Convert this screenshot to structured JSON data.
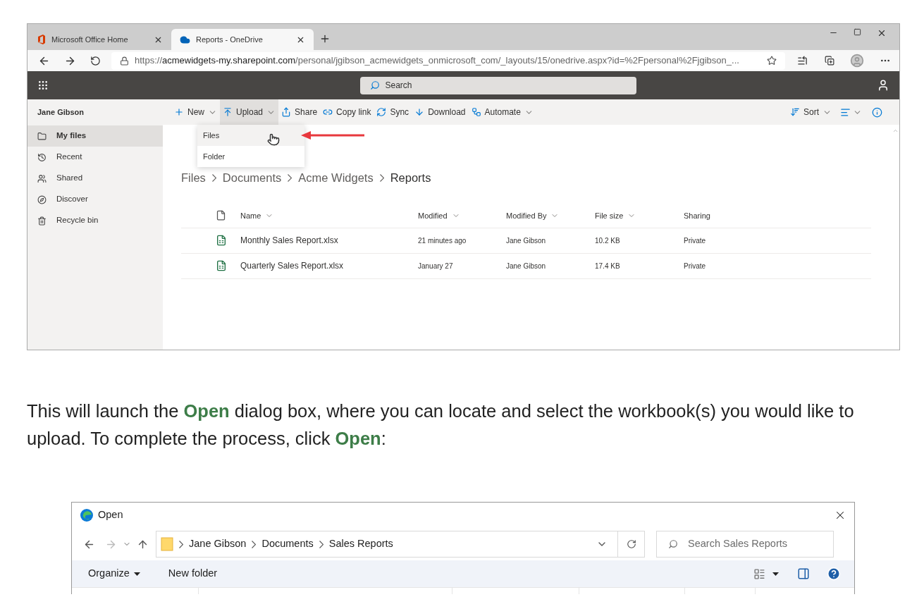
{
  "browser": {
    "tabs": [
      {
        "title": "Microsoft Office Home",
        "selected": false
      },
      {
        "title": "Reports - OneDrive",
        "selected": true
      }
    ],
    "address": {
      "scheme": "https://",
      "host": "acmewidgets-my.sharepoint.com",
      "path": "/personal/jgibson_acmewidgets_onmicrosoft_com/_layouts/15/onedrive.aspx?id=%2Fpersonal%2Fjgibson_..."
    }
  },
  "onedrive": {
    "search_placeholder": "Search",
    "user_name": "Jane Gibson",
    "commands": [
      {
        "label": "New",
        "menu": true,
        "selected": false
      },
      {
        "label": "Upload",
        "menu": true,
        "selected": true
      },
      {
        "label": "Share",
        "menu": false,
        "selected": false
      },
      {
        "label": "Copy link",
        "menu": false,
        "selected": false
      },
      {
        "label": "Sync",
        "menu": false,
        "selected": false
      },
      {
        "label": "Download",
        "menu": false,
        "selected": false
      },
      {
        "label": "Automate",
        "menu": true,
        "selected": false
      }
    ],
    "sort_label": "Sort",
    "nav": [
      {
        "label": "My files",
        "selected": true
      },
      {
        "label": "Recent",
        "selected": false
      },
      {
        "label": "Shared",
        "selected": false
      },
      {
        "label": "Discover",
        "selected": false
      },
      {
        "label": "Recycle bin",
        "selected": false
      }
    ],
    "upload_menu": [
      {
        "label": "Files",
        "selected": true
      },
      {
        "label": "Folder",
        "selected": false
      }
    ],
    "breadcrumb": [
      "Files",
      "Documents",
      "Acme Widgets",
      "Reports"
    ],
    "table": {
      "columns": [
        {
          "label": "Name",
          "sortable": true
        },
        {
          "label": "Modified",
          "sortable": true
        },
        {
          "label": "Modified By",
          "sortable": true
        },
        {
          "label": "File size",
          "sortable": true
        },
        {
          "label": "Sharing",
          "sortable": false
        }
      ],
      "rows": [
        {
          "name": "Monthly Sales Report.xlsx",
          "modified": "21 minutes ago",
          "modified_by": "Jane Gibson",
          "size": "10.2 KB",
          "sharing": "Private"
        },
        {
          "name": "Quarterly Sales Report.xlsx",
          "modified": "January 27",
          "modified_by": "Jane Gibson",
          "size": "17.4 KB",
          "sharing": "Private"
        }
      ]
    }
  },
  "paragraph": "This will launch the **Open** dialog box, where you can locate and select the workbook(s) you would like to upload. To complete the process, click **Open**:",
  "dialog": {
    "title": "Open",
    "path": [
      "Jane Gibson",
      "Documents",
      "Sales Reports"
    ],
    "search_placeholder": "Search Sales Reports",
    "toolbar": [
      {
        "label": "Organize",
        "menu": true
      },
      {
        "label": "New folder",
        "menu": false
      }
    ]
  }
}
